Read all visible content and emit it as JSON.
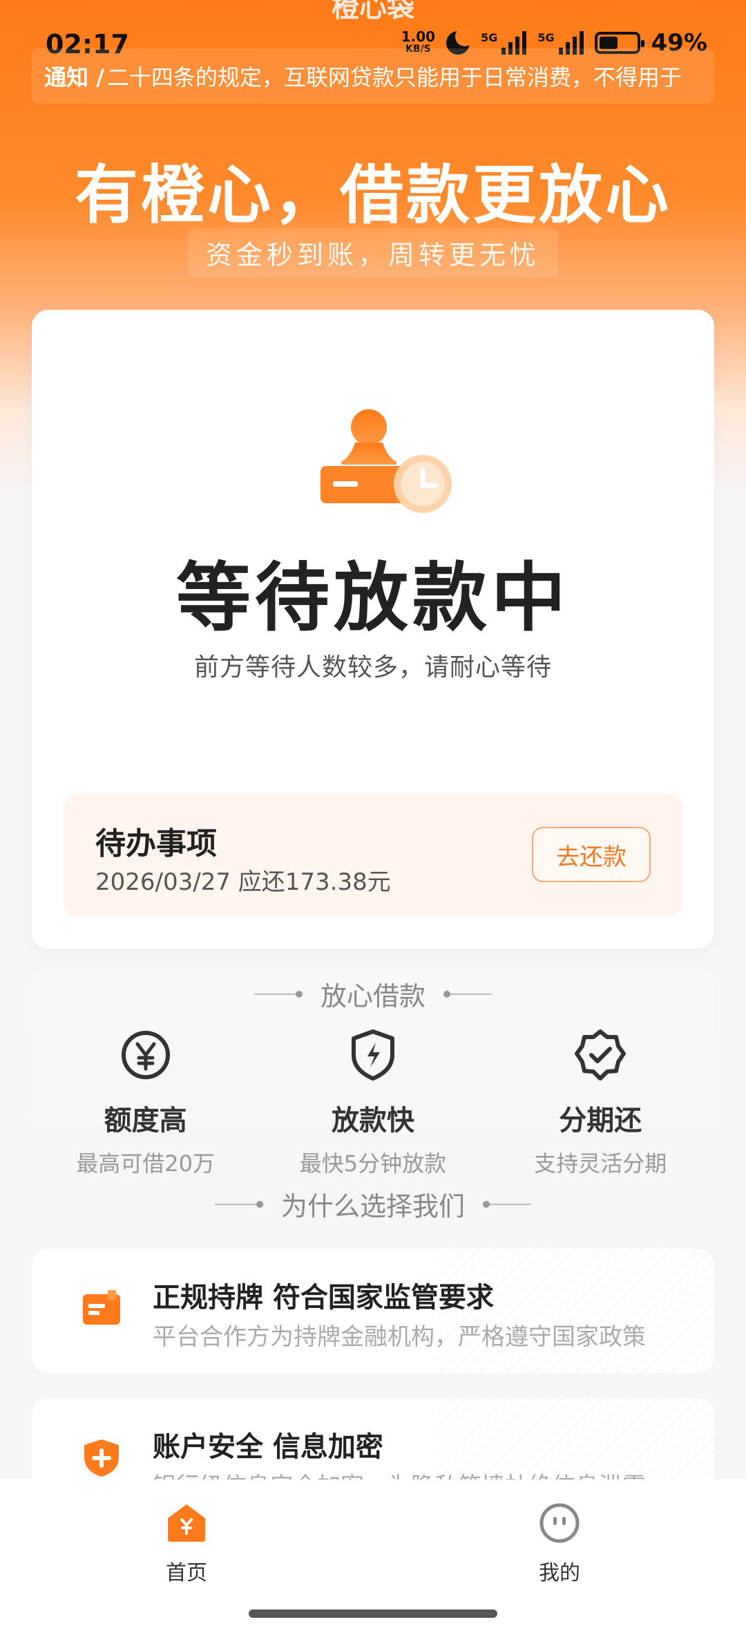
{
  "status_bar": {
    "app_title": "橙心袋",
    "time": "02:17",
    "net_speed_value": "1.00",
    "net_speed_unit": "KB/S",
    "sim1_label": "5G",
    "sim2_label": "5G",
    "battery_level": 0.49,
    "battery_text": "49%"
  },
  "notice": {
    "tag": "通知 /",
    "text": "二十四条的规定，互联网贷款只能用于日常消费，不得用于"
  },
  "hero": {
    "title": "有橙心，借款更放心",
    "subtitle": "资金秒到账，周转更无忧"
  },
  "status_card": {
    "title": "等待放款中",
    "subtitle": "前方等待人数较多，请耐心等待",
    "todo": {
      "title": "待办事项",
      "desc": "2026/03/27 应还173.38元",
      "button": "去还款"
    }
  },
  "features_section": {
    "heading": "放心借款",
    "items": [
      {
        "icon": "yen-circle-icon",
        "title": "额度高",
        "desc": "最高可借20万"
      },
      {
        "icon": "shield-bolt-icon",
        "title": "放款快",
        "desc": "最快5分钟放款"
      },
      {
        "icon": "badge-check-icon",
        "title": "分期还",
        "desc": "支持灵活分期"
      }
    ]
  },
  "why_section": {
    "heading": "为什么选择我们",
    "items": [
      {
        "icon": "license-icon",
        "title": "正规持牌 符合国家监管要求",
        "desc": "平台合作方为持牌金融机构，严格遵守国家政策"
      },
      {
        "icon": "shield-plus-icon",
        "title": "账户安全 信息加密",
        "desc": "银行级信息安全加密，为隐私筑墙杜绝信息泄露"
      }
    ]
  },
  "bottom_nav": {
    "items": [
      {
        "label": "首页",
        "icon": "home-icon",
        "active": true
      },
      {
        "label": "我的",
        "icon": "profile-icon",
        "active": false
      }
    ]
  },
  "colors": {
    "brand": "#ff7a16",
    "accent_text": "#f57a1e"
  }
}
